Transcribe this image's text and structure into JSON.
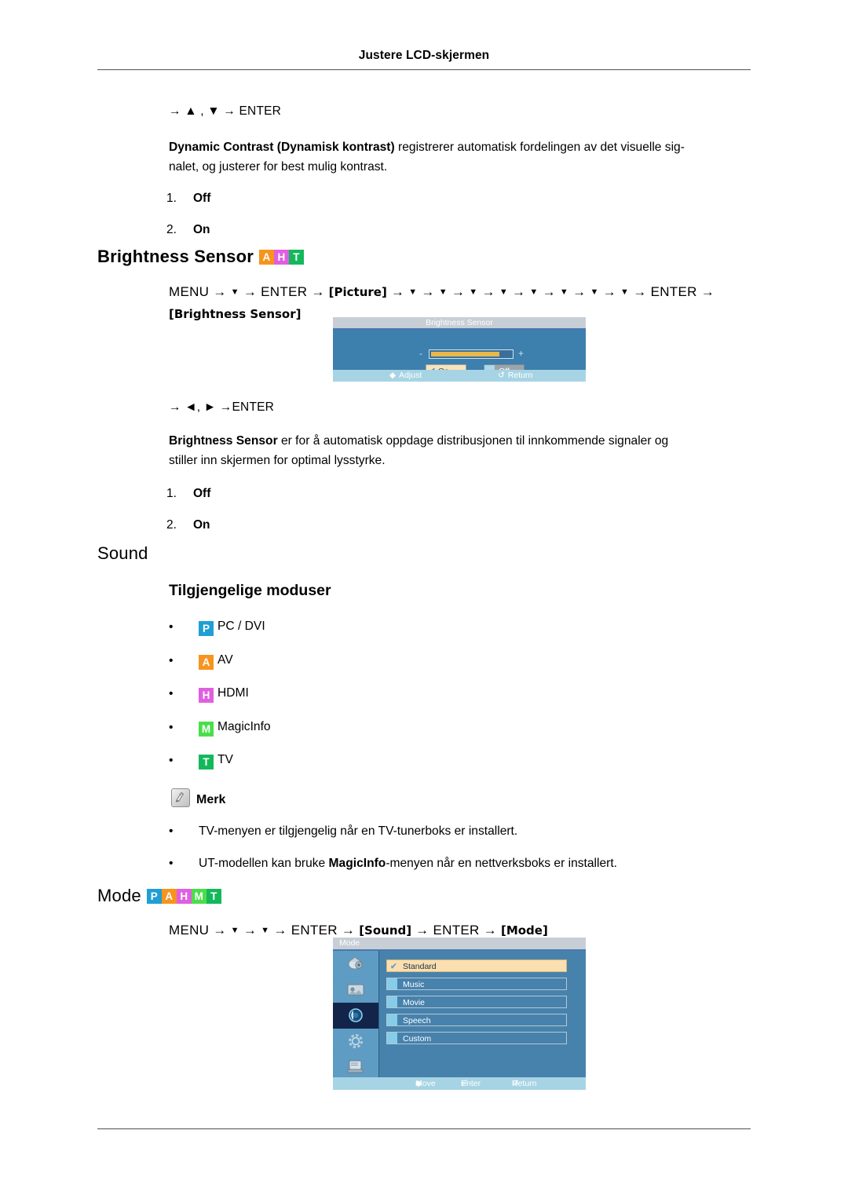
{
  "header": {
    "running_head": "Justere LCD-skjermen"
  },
  "badge_colors": {
    "P": "#1f9fd4",
    "A": "#f7941e",
    "H": "#e05fe0",
    "M": "#4ade4a",
    "T": "#14b85a"
  },
  "dynamic_contrast": {
    "key_line": {
      "arrow": "→",
      "up": "▲",
      "comma": ",",
      "down": "▼",
      "arrow2": "→",
      "enter": "ENTER"
    },
    "key_line_text": "→ ▲ , ▼ → ENTER",
    "paragraph_bold": "Dynamic Contrast (Dynamisk kontrast)",
    "paragraph_rest": " registrerer automatisk fordelingen av det visuelle sig-nalet, og justerer for best mulig kontrast.",
    "paragraph_line1_bold": "Dynamic Contrast (Dynamisk kontrast)",
    "paragraph_line1_rest": " registrerer automatisk fordelingen av det visuelle sig-",
    "paragraph_line2": "nalet, og justerer for best mulig kontrast.",
    "options": [
      {
        "num": "1.",
        "value": "Off"
      },
      {
        "num": "2.",
        "value": "On"
      }
    ]
  },
  "brightness_sensor": {
    "heading": "Brightness Sensor",
    "heading_badges": [
      "A",
      "H",
      "T"
    ],
    "path_line1": "MENU → ▼ → ENTER → [Picture] → ▼ → ▼ → ▼ → ▼ → ▼ → ▼ → ▼ → ▼ → ENTER →",
    "path_line2": "[Brightness Sensor]",
    "path_tokens": {
      "menu": "MENU",
      "enter": "ENTER",
      "picture": "[Picture]",
      "brightness_sensor": "[Brightness Sensor]",
      "arrow": "→",
      "down": "▼",
      "down_count": 8
    },
    "key_line_text": "→ ◄, ► →ENTER",
    "paragraph_bold": "Brightness Sensor",
    "paragraph_line1_rest": " er for å automatisk oppdage distribusjonen til innkommende signaler og",
    "paragraph_line2": "stiller inn skjermen for optimal lysstyrke.",
    "options": [
      {
        "num": "1.",
        "value": "Off"
      },
      {
        "num": "2.",
        "value": "On"
      }
    ],
    "osd": {
      "title": "Brightness Sensor",
      "minus": "-",
      "plus": "+",
      "slider_fill_percent": 82,
      "buttons": [
        {
          "label": "On",
          "checked": true
        },
        {
          "label": "Off",
          "checked": false
        }
      ],
      "footer": [
        {
          "icon": "left-right-adjust-icon",
          "glyph": "◆",
          "label": "Adjust"
        },
        {
          "icon": "return-icon",
          "glyph": "↺",
          "label": "Return"
        }
      ]
    }
  },
  "sound": {
    "heading": "Sound",
    "subheading": "Tilgjengelige moduser",
    "modes": [
      {
        "badge": "P",
        "label": "PC / DVI"
      },
      {
        "badge": "A",
        "label": "AV"
      },
      {
        "badge": "H",
        "label": "HDMI"
      },
      {
        "badge": "M",
        "label": "MagicInfo"
      },
      {
        "badge": "T",
        "label": "TV"
      }
    ],
    "note": {
      "icon": "note-pencil-icon",
      "label": "Merk",
      "items": [
        {
          "text": "TV-menyen er tilgjengelig når en TV-tunerboks er installert.",
          "bold": ""
        },
        {
          "pre": "UT-modellen kan bruke ",
          "bold": "MagicInfo",
          "post": "-menyen når en nettverksboks er installert."
        }
      ]
    }
  },
  "mode": {
    "heading": "Mode",
    "heading_badges": [
      "P",
      "A",
      "H",
      "M",
      "T"
    ],
    "path_line": "MENU → ▼ →▼ → ENTER → [Sound] → ENTER → [Mode]",
    "path_tokens": {
      "menu": "MENU",
      "enter": "ENTER",
      "sound": "[Sound]",
      "mode": "[Mode]",
      "arrow": "→",
      "down": "▼"
    },
    "osd": {
      "title": "Mode",
      "sidebar_icons": [
        "input-source-icon",
        "picture-icon",
        "sound-icon",
        "setup-icon",
        "multi-control-icon"
      ],
      "selected_sidebar_index": 2,
      "items": [
        {
          "label": "Standard",
          "selected": true
        },
        {
          "label": "Music",
          "selected": false
        },
        {
          "label": "Movie",
          "selected": false
        },
        {
          "label": "Speech",
          "selected": false
        },
        {
          "label": "Custom",
          "selected": false
        }
      ],
      "footer": [
        {
          "icon": "move-icon",
          "glyph": "◆",
          "label": "Move"
        },
        {
          "icon": "enter-icon",
          "glyph": "⏎",
          "label": "Enter"
        },
        {
          "icon": "return-icon",
          "glyph": "↺",
          "label": "Return"
        }
      ]
    }
  }
}
